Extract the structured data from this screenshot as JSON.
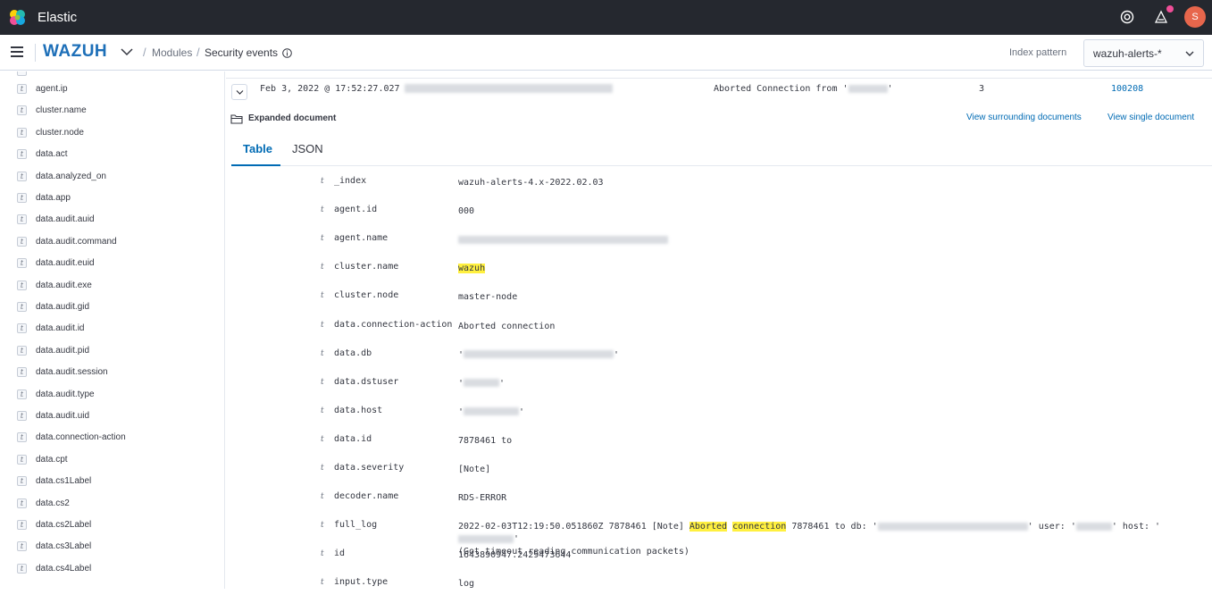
{
  "app": {
    "title": "Elastic",
    "avatar_initial": "S"
  },
  "header": {
    "brand": "WAZUH",
    "breadcrumb": [
      "Modules",
      "Security events"
    ],
    "index_pattern_label": "Index pattern",
    "index_pattern_value": "wazuh-alerts-*"
  },
  "sidebar": {
    "fields": [
      "agent.ip",
      "cluster.name",
      "cluster.node",
      "data.act",
      "data.analyzed_on",
      "data.app",
      "data.audit.auid",
      "data.audit.command",
      "data.audit.euid",
      "data.audit.exe",
      "data.audit.gid",
      "data.audit.id",
      "data.audit.pid",
      "data.audit.session",
      "data.audit.type",
      "data.audit.uid",
      "data.connection-action",
      "data.cpt",
      "data.cs1Label",
      "data.cs2",
      "data.cs2Label",
      "data.cs3Label",
      "data.cs4Label"
    ]
  },
  "event": {
    "timestamp": "Feb 3, 2022 @ 17:52:27.027",
    "description": "Aborted Connection from '",
    "description_end": "'",
    "level": "3",
    "rule_id": "100208"
  },
  "expanded": {
    "label": "Expanded document",
    "link_surrounding": "View surrounding documents",
    "link_single": "View single document",
    "tabs": [
      "Table",
      "JSON"
    ]
  },
  "doc": {
    "rows": [
      {
        "key": "_index",
        "value": "wazuh-alerts-4.x-2022.02.03"
      },
      {
        "key": "agent.id",
        "value": "000"
      },
      {
        "key": "agent.name",
        "value": ""
      },
      {
        "key": "cluster.name",
        "value": "wazuh"
      },
      {
        "key": "cluster.node",
        "value": "master-node"
      },
      {
        "key": "data.connection-action",
        "value": "Aborted connection"
      },
      {
        "key": "data.db",
        "value": "'"
      },
      {
        "key": "data.dstuser",
        "value": "'"
      },
      {
        "key": "data.host",
        "value": "'"
      },
      {
        "key": "data.id",
        "value": "7878461 to"
      },
      {
        "key": "data.severity",
        "value": "[Note]"
      },
      {
        "key": "decoder.name",
        "value": "RDS-ERROR"
      },
      {
        "key": "full_log",
        "value": ""
      },
      {
        "key": "id",
        "value": "1643890947.2429473644"
      },
      {
        "key": "input.type",
        "value": "log"
      }
    ],
    "full_log": {
      "p1": "2022-02-03T12:19:50.051860Z 7878461 [Note] ",
      "h1": "Aborted",
      "h2": "connection",
      "p2": " 7878461 to db: '",
      "p3": "' user: '",
      "p4": "' host: '",
      "p5": "'",
      "line2": "(Got timeout reading communication packets)"
    }
  }
}
